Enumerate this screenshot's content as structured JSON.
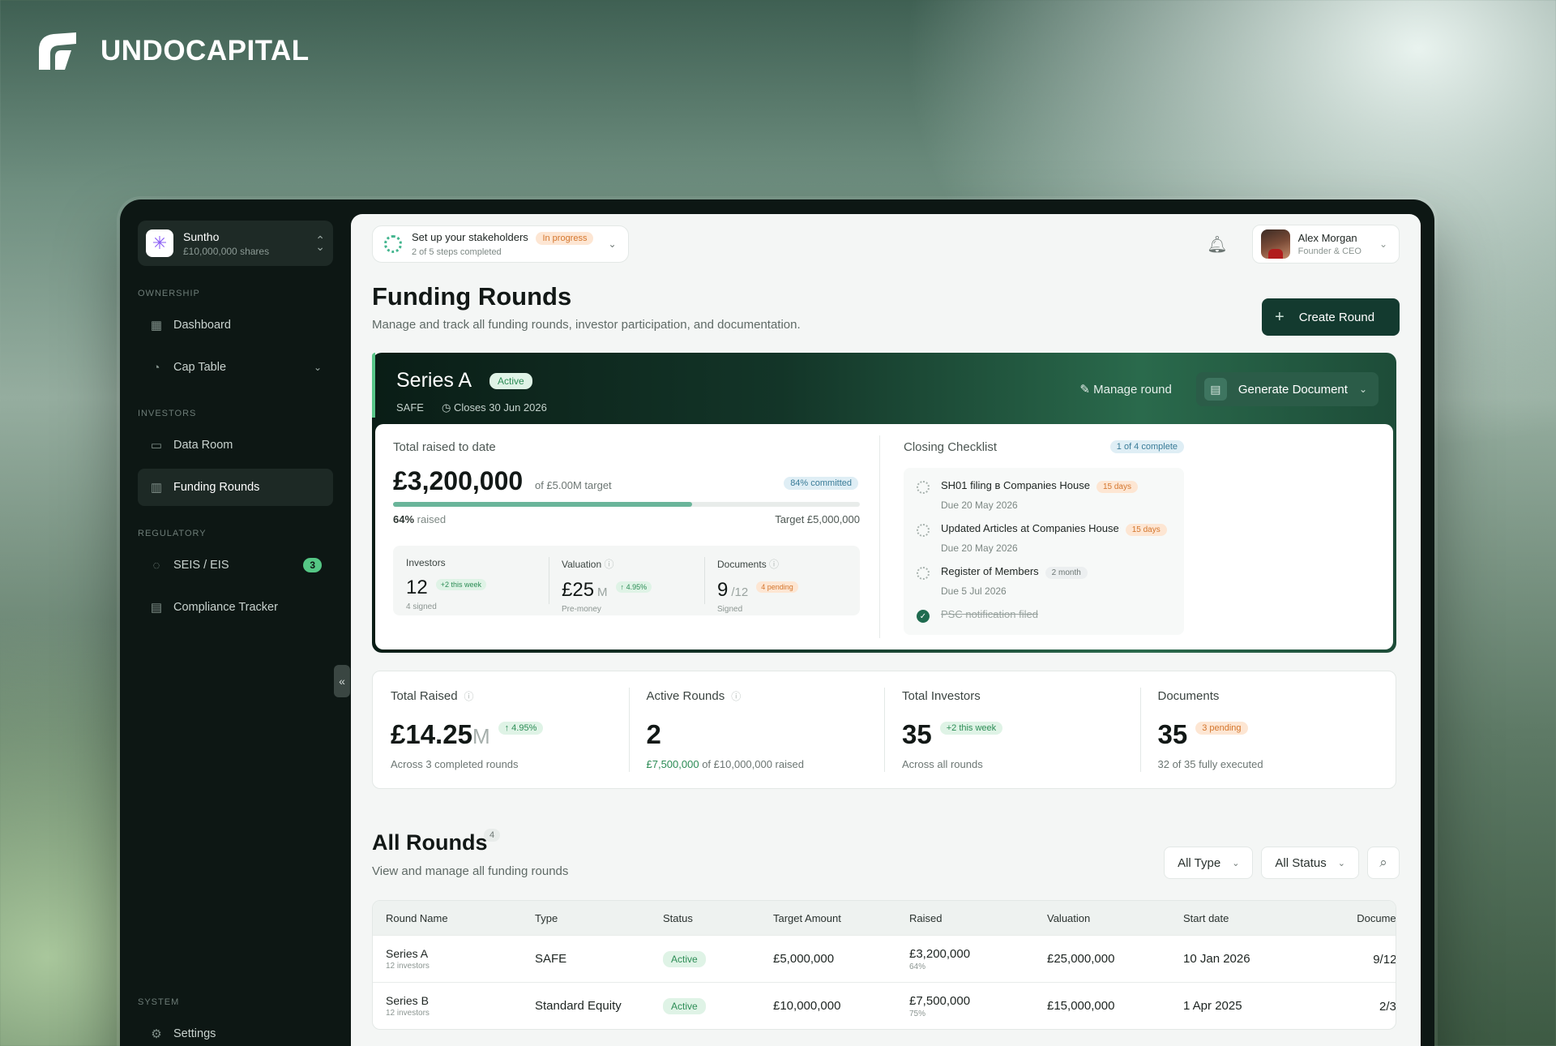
{
  "brand": {
    "name": "UNDOCAPITAL"
  },
  "sidebar": {
    "org": {
      "name": "Suntho",
      "shares": "£10,000,000 shares"
    },
    "sections": {
      "ownership": "OWNERSHIP",
      "investors": "INVESTORS",
      "regulatory": "REGULATORY",
      "system": "SYSTEM"
    },
    "items": {
      "dashboard": "Dashboard",
      "cap_table": "Cap Table",
      "data_room": "Data Room",
      "funding_rounds": "Funding Rounds",
      "seis_eis": "SEIS / EIS",
      "seis_eis_badge": "3",
      "compliance": "Compliance Tracker",
      "settings": "Settings"
    }
  },
  "topbar": {
    "setup_title": "Set up your stakeholders",
    "setup_status": "In progress",
    "setup_progress": "2 of 5 steps completed",
    "user_name": "Alex Morgan",
    "user_role": "Founder & CEO"
  },
  "page": {
    "title": "Funding Rounds",
    "subtitle": "Manage and track all funding rounds, investor participation, and documentation.",
    "create_button": "Create Round"
  },
  "current_round": {
    "name": "Series A",
    "status": "Active",
    "type": "SAFE",
    "closes": "Closes 30 Jun 2026",
    "manage": "Manage round",
    "generate": "Generate Document",
    "raised_label": "Total raised to date",
    "raised_amount": "£3,200,000",
    "raised_of": "of £5.00M target",
    "committed": "84% committed",
    "progress_percent": 64,
    "progress_pct_text": "64%",
    "progress_raised_word": "raised",
    "target_text": "Target £5,000,000",
    "investors": {
      "label": "Investors",
      "value": "12",
      "pill": "+2 this week",
      "sub": "4 signed"
    },
    "valuation": {
      "label": "Valuation",
      "value": "£25",
      "unit": "M",
      "pill": "4.95%",
      "sub": "Pre-money"
    },
    "documents": {
      "label": "Documents",
      "value": "9",
      "unit": "/12",
      "pill": "4 pending",
      "sub": "Signed"
    },
    "checklist": {
      "title": "Closing Checklist",
      "count": "1 of 4 complete",
      "items": [
        {
          "name": "SH01 filing в Companies House",
          "tag": "15 days",
          "due": "Due 20 May 2026"
        },
        {
          "name": "Updated Articles at Companies House",
          "tag": "15 days",
          "due": "Due 20 May 2026"
        },
        {
          "name": "Register of Members",
          "tag": "2 month",
          "due": "Due 5 Jul 2026"
        },
        {
          "name": "PSC notification filed"
        }
      ]
    }
  },
  "stats": {
    "total_raised": {
      "label": "Total Raised",
      "value": "£14.25",
      "unit": "M",
      "pill": "4.95%",
      "sub": "Across 3 completed rounds"
    },
    "active_rounds": {
      "label": "Active Rounds",
      "value": "2",
      "sub_highlight": "£7,500,000",
      "sub_rest": "of £10,000,000 raised"
    },
    "total_investors": {
      "label": "Total Investors",
      "value": "35",
      "pill": "+2 this week",
      "sub": "Across all rounds"
    },
    "documents": {
      "label": "Documents",
      "value": "35",
      "pill": "3 pending",
      "sub": "32 of 35 fully executed"
    }
  },
  "rounds": {
    "title": "All Rounds",
    "count": "4",
    "subtitle": "View and manage all funding rounds",
    "filter_type": "All Type",
    "filter_status": "All Status",
    "columns": [
      "Round Name",
      "Type",
      "Status",
      "Target Amount",
      "Raised",
      "Valuation",
      "Start date",
      "Documents"
    ],
    "rows": [
      {
        "name": "Series A",
        "investors": "12 investors",
        "type": "SAFE",
        "status": "Active",
        "target": "£5,000,000",
        "raised": "£3,200,000",
        "raised_pct": "64%",
        "valuation": "£25,000,000",
        "start": "10 Jan 2026",
        "docs": "9/12"
      },
      {
        "name": "Series B",
        "investors": "12 investors",
        "type": "Standard Equity",
        "status": "Active",
        "target": "£10,000,000",
        "raised": "£7,500,000",
        "raised_pct": "75%",
        "valuation": "£15,000,000",
        "start": "1 Apr 2025",
        "docs": "2/3"
      }
    ]
  }
}
